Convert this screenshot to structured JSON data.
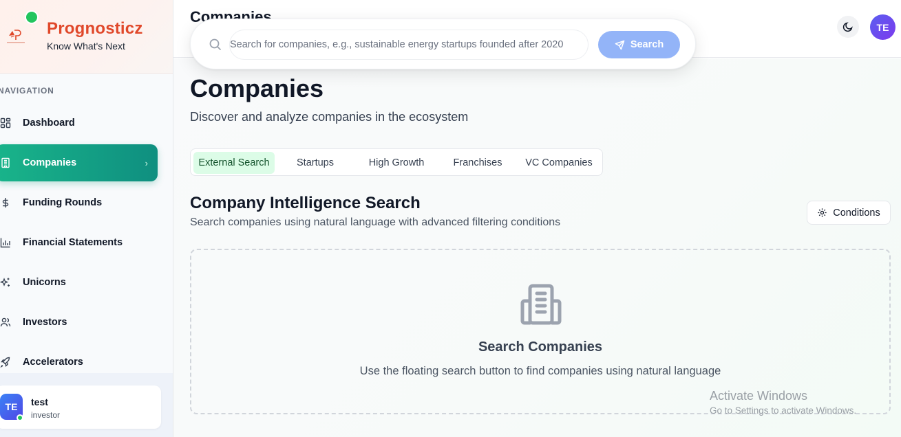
{
  "brand": {
    "name": "Prognosticz",
    "tagline": "Know What's Next",
    "logo_text": "PROGNOSTICZ",
    "accent": "#e0482a"
  },
  "sidebar": {
    "heading": "NAVIGATION",
    "items": [
      {
        "label": "Dashboard",
        "icon": "grid-icon"
      },
      {
        "label": "Companies",
        "icon": "building-icon",
        "active": true
      },
      {
        "label": "Funding Rounds",
        "icon": "dollar-icon"
      },
      {
        "label": "Financial Statements",
        "icon": "bar-chart-icon"
      },
      {
        "label": "Unicorns",
        "icon": "sparkles-icon"
      },
      {
        "label": "Investors",
        "icon": "users-icon"
      },
      {
        "label": "Accelerators",
        "icon": "rocket-icon"
      }
    ],
    "active_color": "#12a284"
  },
  "user": {
    "initials": "TE",
    "name": "test",
    "role": "investor",
    "status": "online"
  },
  "topbar": {
    "title": "Companies",
    "avatar_initials": "TE"
  },
  "search": {
    "placeholder": "Search for companies, e.g., sustainable energy startups founded after 2020",
    "button_label": "Search"
  },
  "page": {
    "title": "Companies",
    "subtitle": "Discover and analyze companies in the ecosystem"
  },
  "tabs": [
    {
      "label": "External Search",
      "active": true
    },
    {
      "label": "Startups"
    },
    {
      "label": "High Growth"
    },
    {
      "label": "Franchises"
    },
    {
      "label": "VC Companies"
    }
  ],
  "section": {
    "title": "Company Intelligence Search",
    "subtitle": "Search companies using natural language with advanced filtering conditions",
    "conditions_label": "Conditions"
  },
  "empty_state": {
    "title": "Search Companies",
    "message": "Use the floating search button to find companies using natural language"
  },
  "watermark": {
    "line1": "Activate Windows",
    "line2": "Go to Settings to activate Windows."
  }
}
